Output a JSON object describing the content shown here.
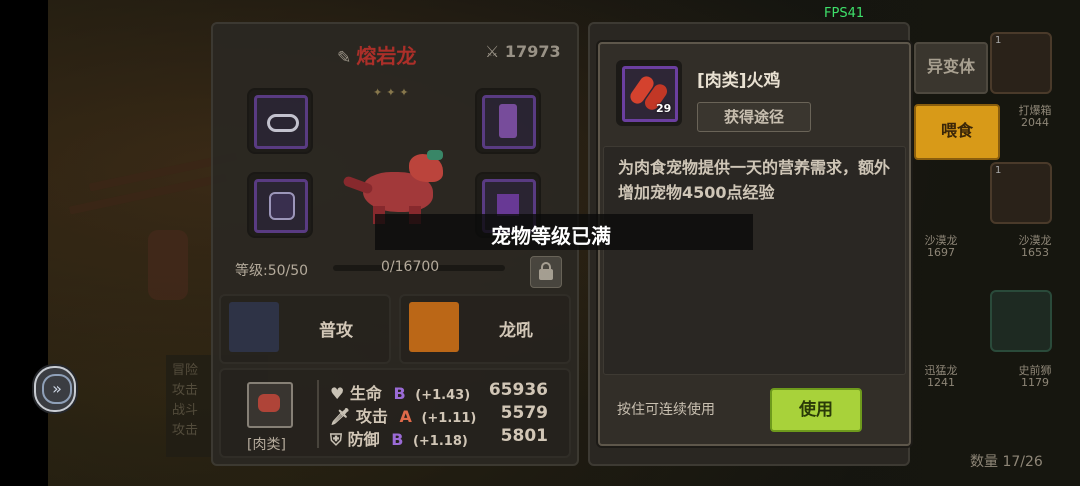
{
  "fps": "FPS41",
  "pet": {
    "name": "熔岩龙",
    "power_icon": "crossed-swords-icon",
    "power": "17973",
    "stars": "✦✦✦",
    "level_label": "等级:50/50",
    "exp_text": "0/16700",
    "exp_progress": 0,
    "skills": [
      {
        "name": "普攻",
        "icon": "claw-icon"
      },
      {
        "name": "龙吼",
        "icon": "roar-icon"
      }
    ],
    "food_type": "[肉类]",
    "stats": [
      {
        "icon": "heart-icon",
        "name": "生命",
        "grade": "B",
        "bonus": "(+1.43)",
        "value": "65936",
        "grade_color": "#9b6bd6"
      },
      {
        "icon": "sword-icon",
        "name": "攻击",
        "grade": "A",
        "bonus": "(+1.11)",
        "value": "5579",
        "grade_color": "#e06a4a"
      },
      {
        "icon": "shield-icon",
        "name": "防御",
        "grade": "B",
        "bonus": "(+1.18)",
        "value": "5801",
        "grade_color": "#9b6bd6"
      }
    ]
  },
  "item": {
    "name": "[肉类]火鸡",
    "count": "29",
    "obtain_label": "获得途径",
    "description": "为肉食宠物提供一天的营养需求，额外增加宠物4500点经验",
    "hold_hint": "按住可连续使用",
    "use_label": "使用"
  },
  "side": {
    "mutant_tab": "异变体",
    "feed_tab": "喂食",
    "count_label": "数量 17/26",
    "cards": [
      {
        "slot": "1",
        "name": "打爆箱",
        "num": "2044"
      },
      {
        "slot": "1",
        "name": "沙漠龙",
        "num": "1697"
      },
      {
        "slot": "1",
        "name": "沙漠龙",
        "num": "1653"
      },
      {
        "slot": "",
        "name": "迅猛龙",
        "num": "1241"
      },
      {
        "slot": "",
        "name": "史前狮",
        "num": "1179"
      }
    ]
  },
  "toast": "宠物等级已满",
  "colors": {
    "accent_green": "#a8d23a",
    "rare_purple": "#6b3fa0",
    "title_red": "#b0302a"
  }
}
